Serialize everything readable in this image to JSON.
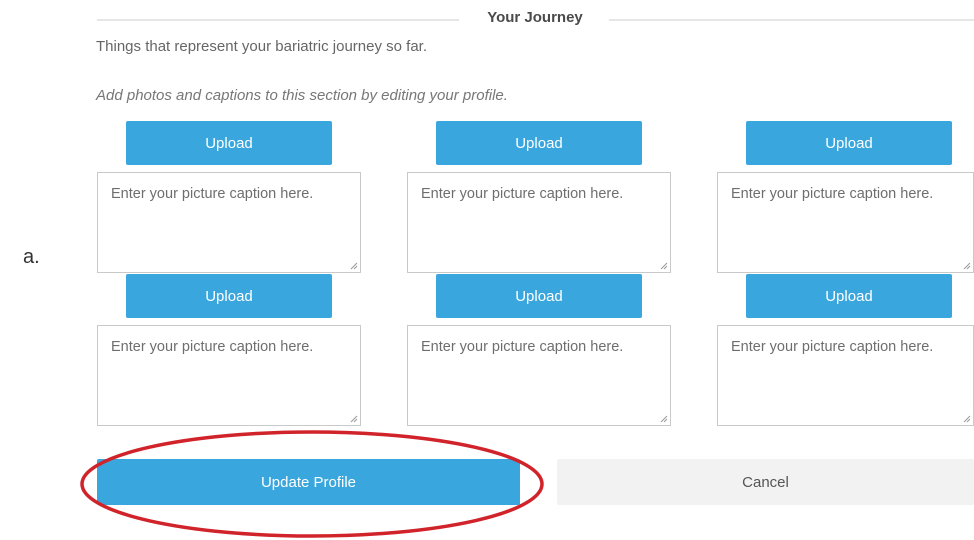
{
  "item_label": "a.",
  "section": {
    "title": "Your Journey",
    "description": "Things that represent your bariatric journey so far.",
    "instruction": "Add photos and captions to this section by editing your profile."
  },
  "slots": [
    {
      "upload_label": "Upload",
      "caption_placeholder": "Enter your picture caption here."
    },
    {
      "upload_label": "Upload",
      "caption_placeholder": "Enter your picture caption here."
    },
    {
      "upload_label": "Upload",
      "caption_placeholder": "Enter your picture caption here."
    },
    {
      "upload_label": "Upload",
      "caption_placeholder": "Enter your picture caption here."
    },
    {
      "upload_label": "Upload",
      "caption_placeholder": "Enter your picture caption here."
    },
    {
      "upload_label": "Upload",
      "caption_placeholder": "Enter your picture caption here."
    }
  ],
  "actions": {
    "update_label": "Update Profile",
    "cancel_label": "Cancel"
  },
  "colors": {
    "accent": "#3aa6de",
    "highlight": "#d0232a",
    "cancel_bg": "#f2f2f2"
  }
}
